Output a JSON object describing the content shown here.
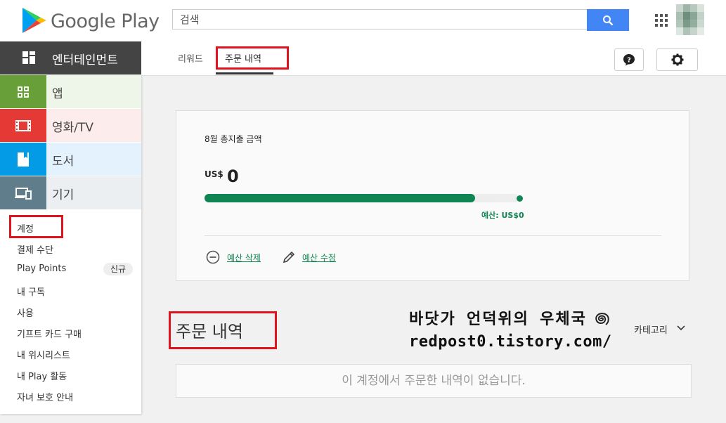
{
  "header": {
    "logo_text": "Google Play",
    "search_placeholder": "검색"
  },
  "nav": {
    "category_title": "엔터테인먼트",
    "tabs": [
      {
        "label": "리워드"
      },
      {
        "label": "주문 내역"
      }
    ]
  },
  "sidebar": {
    "categories": [
      {
        "label": "앱",
        "color": "#689f38"
      },
      {
        "label": "영화/TV",
        "color": "#e53935"
      },
      {
        "label": "도서",
        "color": "#039be5"
      },
      {
        "label": "기기",
        "color": "#607d8b"
      }
    ],
    "items": [
      {
        "label": "계정"
      },
      {
        "label": "결제 수단"
      },
      {
        "label": "Play Points",
        "badge": "신규"
      },
      {
        "label": "내 구독"
      },
      {
        "label": "사용"
      },
      {
        "label": "기프트 카드 구매"
      },
      {
        "label": "내 위시리스트"
      },
      {
        "label": "내 Play 활동"
      },
      {
        "label": "자녀 보호 안내"
      }
    ]
  },
  "budget": {
    "title": "8월 총지출 금액",
    "currency": "US$",
    "amount": "0",
    "budget_label": "예산: US$0",
    "progress": 0.86,
    "delete_label": "예산 삭제",
    "edit_label": "예산 수정",
    "accent_color": "#0f8553"
  },
  "orders": {
    "title": "주문 내역",
    "category_label": "카테고리",
    "empty_message": "이 계정에서 주문한 내역이 없습니다."
  },
  "watermark": {
    "line1": "바닷가 언덕위의 우체국",
    "line2": "redpost0.tistory.com/"
  }
}
